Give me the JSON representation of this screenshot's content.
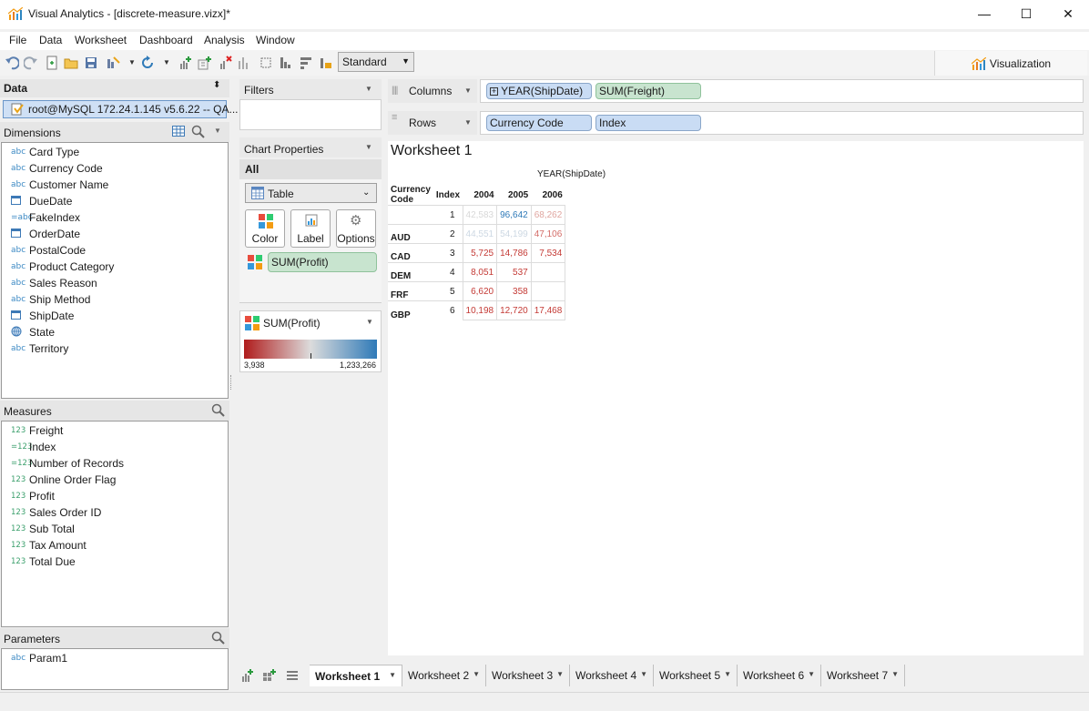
{
  "window": {
    "title": "Visual Analytics - [discrete-measure.vizx]*",
    "minimize": "—",
    "maximize": "☐",
    "close": "✕"
  },
  "menu": [
    "File",
    "Data",
    "Worksheet",
    "Dashboard",
    "Analysis",
    "Window"
  ],
  "toolbar": {
    "fit_select": "Standard",
    "visualization_tab": "Visualization"
  },
  "data_pane": {
    "title": "Data",
    "connection": "root@MySQL 172.24.1.145 v5.6.22 -- QA...",
    "dimensions_title": "Dimensions",
    "dimensions": [
      {
        "icon": "abc",
        "label": "Card Type"
      },
      {
        "icon": "abc",
        "label": "Currency Code"
      },
      {
        "icon": "abc",
        "label": "Customer Name"
      },
      {
        "icon": "date",
        "label": "DueDate"
      },
      {
        "icon": "fabc",
        "label": "FakeIndex"
      },
      {
        "icon": "date",
        "label": "OrderDate"
      },
      {
        "icon": "abc",
        "label": "PostalCode"
      },
      {
        "icon": "abc",
        "label": "Product Category"
      },
      {
        "icon": "abc",
        "label": "Sales Reason"
      },
      {
        "icon": "abc",
        "label": "Ship Method"
      },
      {
        "icon": "date",
        "label": "ShipDate"
      },
      {
        "icon": "geo",
        "label": "State"
      },
      {
        "icon": "abc",
        "label": "Territory"
      }
    ],
    "measures_title": "Measures",
    "measures": [
      {
        "icon": "123",
        "label": "Freight"
      },
      {
        "icon": "f123",
        "label": "Index"
      },
      {
        "icon": "f123",
        "label": "Number of Records"
      },
      {
        "icon": "123",
        "label": "Online Order Flag"
      },
      {
        "icon": "123",
        "label": "Profit"
      },
      {
        "icon": "123",
        "label": "Sales Order ID"
      },
      {
        "icon": "123",
        "label": "Sub Total"
      },
      {
        "icon": "123",
        "label": "Tax Amount"
      },
      {
        "icon": "123",
        "label": "Total Due"
      }
    ],
    "parameters_title": "Parameters",
    "parameters": [
      {
        "icon": "abc",
        "label": "Param1"
      }
    ]
  },
  "filters": {
    "title": "Filters"
  },
  "chart_properties": {
    "title": "Chart Properties",
    "scope": "All",
    "chart_type": "Table",
    "buttons": [
      "Color",
      "Label",
      "Options"
    ],
    "color_field": "SUM(Profit)"
  },
  "legend": {
    "title": "SUM(Profit)",
    "min": "3,938",
    "max": "1,233,266",
    "color_low": "#b01c1c",
    "color_mid": "#dcdcdc",
    "color_high": "#2f7ab8"
  },
  "shelves": {
    "columns_label": "Columns",
    "columns": [
      "YEAR(ShipDate)",
      "SUM(Freight)"
    ],
    "rows_label": "Rows",
    "rows": [
      "Currency Code",
      "Index"
    ]
  },
  "worksheet": {
    "title": "Worksheet 1",
    "col_header": "YEAR(ShipDate)",
    "row_headers": [
      "Currency Code",
      "Index"
    ],
    "years": [
      "2004",
      "2005",
      "2006"
    ],
    "rows": [
      {
        "code": "",
        "index": "1",
        "cells": [
          {
            "v": "42,583",
            "c": "#d8d8d8"
          },
          {
            "v": "96,642",
            "c": "#2f7ab8"
          },
          {
            "v": "68,262",
            "c": "#e0a6a0"
          }
        ]
      },
      {
        "code": "AUD",
        "index": "2",
        "cells": [
          {
            "v": "44,551",
            "c": "#cdd8e3"
          },
          {
            "v": "54,199",
            "c": "#cdd8e3"
          },
          {
            "v": "47,106",
            "c": "#d36b66"
          }
        ]
      },
      {
        "code": "CAD",
        "index": "3",
        "cells": [
          {
            "v": "5,725",
            "c": "#c43a35"
          },
          {
            "v": "14,786",
            "c": "#c43a35"
          },
          {
            "v": "7,534",
            "c": "#c43a35"
          }
        ]
      },
      {
        "code": "DEM",
        "index": "4",
        "cells": [
          {
            "v": "8,051",
            "c": "#c43a35"
          },
          {
            "v": "537",
            "c": "#c43a35"
          },
          {
            "v": "",
            "c": "#c43a35"
          }
        ]
      },
      {
        "code": "FRF",
        "index": "5",
        "cells": [
          {
            "v": "6,620",
            "c": "#c43a35"
          },
          {
            "v": "358",
            "c": "#c43a35"
          },
          {
            "v": "",
            "c": "#c43a35"
          }
        ]
      },
      {
        "code": "GBP",
        "index": "6",
        "cells": [
          {
            "v": "10,198",
            "c": "#c43a35"
          },
          {
            "v": "12,720",
            "c": "#c43a35"
          },
          {
            "v": "17,468",
            "c": "#c43a35"
          }
        ]
      }
    ]
  },
  "tabs": [
    "Worksheet 1",
    "Worksheet 2",
    "Worksheet 3",
    "Worksheet 4",
    "Worksheet 5",
    "Worksheet 6",
    "Worksheet 7"
  ],
  "active_tab": "Worksheet 1"
}
